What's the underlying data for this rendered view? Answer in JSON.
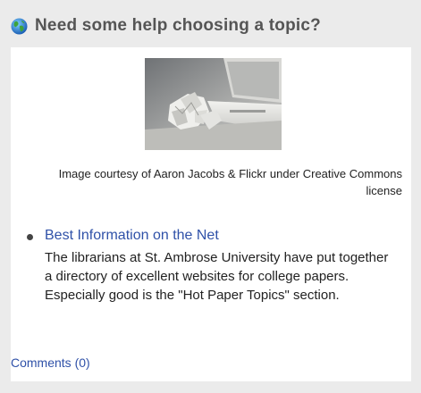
{
  "widget": {
    "title": "Need some help choosing a topic?",
    "icon": "globe-icon",
    "image_caption": "Image courtesy of Aaron Jacobs & Flickr under Creative Commons license",
    "links": [
      {
        "label": "Best Information on the Net",
        "description": "The librarians at St. Ambrose University have put together a directory of excellent websites for college papers. Especially good is the \"Hot Paper Topics\" section."
      }
    ],
    "comments_label": "Comments (0)"
  },
  "colors": {
    "panel_bg": "#ebebeb",
    "link": "#2f51a8",
    "title_text": "#555555"
  }
}
